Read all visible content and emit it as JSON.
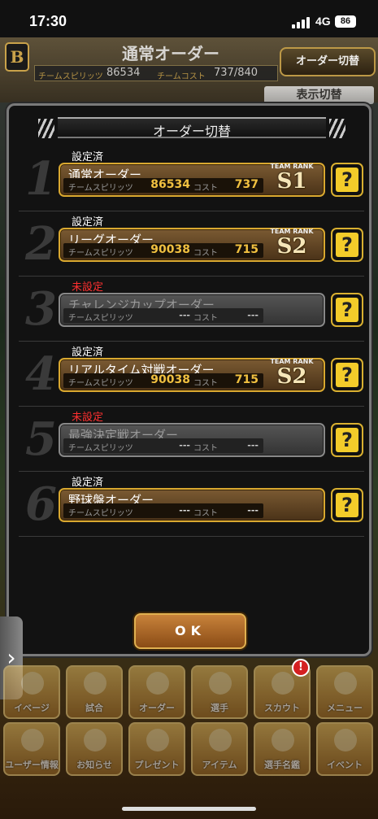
{
  "status_bar": {
    "time": "17:30",
    "network": "4G",
    "battery": "86"
  },
  "header": {
    "logo": "B",
    "title": "通常オーダー",
    "spirits_label": "チームスピリッツ",
    "spirits_value": "86534",
    "cost_label": "チームコスト",
    "cost_value": "737/840",
    "switch_button": "オーダー切替",
    "display_button": "表示切替"
  },
  "modal": {
    "title": "オーダー切替",
    "rank_label": "TEAM RANK",
    "help_glyph": "?",
    "rows": [
      {
        "number": "1",
        "state": "設定済",
        "name": "通常オーダー",
        "spirits_label": "チームスピリッツ",
        "spirits": "86534",
        "cost_label": "コスト",
        "cost": "737",
        "rank": "S1"
      },
      {
        "number": "2",
        "state": "設定済",
        "name": "リーグオーダー",
        "spirits_label": "チームスピリッツ",
        "spirits": "90038",
        "cost_label": "コスト",
        "cost": "715",
        "rank": "S2"
      },
      {
        "number": "3",
        "state": "未設定",
        "name": "チャレンジカップオーダー",
        "spirits_label": "チームスピリッツ",
        "spirits": "---",
        "cost_label": "コスト",
        "cost": "---",
        "rank": ""
      },
      {
        "number": "4",
        "state": "設定済",
        "name": "リアルタイム対戦オーダー",
        "spirits_label": "チームスピリッツ",
        "spirits": "90038",
        "cost_label": "コスト",
        "cost": "715",
        "rank": "S2"
      },
      {
        "number": "5",
        "state": "未設定",
        "name": "最強決定戦オーダー",
        "spirits_label": "チームスピリッツ",
        "spirits": "---",
        "cost_label": "コスト",
        "cost": "---",
        "rank": ""
      },
      {
        "number": "6",
        "state": "設定済",
        "name": "野球盤オーダー",
        "spirits_label": "チームスピリッツ",
        "spirits": "---",
        "cost_label": "コスト",
        "cost": "---",
        "rank": ""
      }
    ],
    "ok_button": "OK"
  },
  "side_tab": "›",
  "menu_top": [
    "イベージ",
    "試合",
    "オーダー",
    "選手",
    "スカウト",
    "メニュー"
  ],
  "menu_bottom": [
    "ユーザー情報",
    "お知らせ",
    "プレゼント",
    "アイテム",
    "選手名鑑",
    "イベント"
  ],
  "scout_badge": "!"
}
